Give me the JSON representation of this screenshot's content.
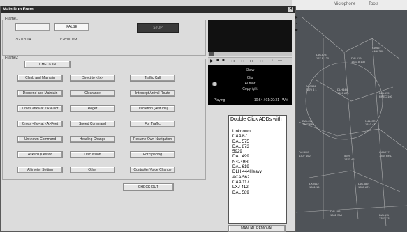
{
  "window": {
    "title": "Main Dun Form"
  },
  "frame1": {
    "label": "Frame1",
    "false_label": "FALSE",
    "stop_label": "STOP",
    "date": "3/27/2004",
    "time": "1:28:00 PM"
  },
  "frame2": {
    "label": "Frame2",
    "check_in": "CHECK IN",
    "check_out": "CHECK OUT",
    "columns": [
      [
        "Climb and Maintain",
        "Descend and Maintain",
        "Cross <fix> at <A>Knot",
        "Cross <fix> at <A>Feet",
        "Unknown Command",
        "Asked Question",
        "Altimeter Setting"
      ],
      [
        "Direct to <fix>",
        "Clearance",
        "Roger",
        "Speed Command",
        "Heading Change",
        "Discussion",
        "Other"
      ],
      [
        "Traffic Call",
        "Intercept Arrival Route",
        "Discretion (Altitude)",
        "For Traffic",
        "Resume Own Navigation",
        "For Spacing",
        "Controller Voice Change"
      ]
    ]
  },
  "player": {
    "show": "Show",
    "clip": "Clip",
    "author": "Author",
    "copyright": "Copyright",
    "status": "Playing",
    "time": "10:54 / 01:20:31",
    "format": "WM"
  },
  "listbox": {
    "header": "Double Click ADDs with",
    "items": [
      "Unknown",
      "CAA 67",
      "DAL 575",
      "DAL 873",
      "5929",
      "DAL 499",
      "N4149R",
      "DAL 619",
      "DLH 444Heavy",
      "ACA 562",
      "CAA 117",
      "LXJ 412",
      "DAL 589"
    ]
  },
  "manual_removal": "MANUAL REMOVAL",
  "desktop": {
    "microphone": "Microphone",
    "tools": "Tools"
  },
  "colors": {
    "titlebar": "#2b2b2b",
    "radar_bg": "#4f5358",
    "window_bg": "#dcdcdc"
  }
}
